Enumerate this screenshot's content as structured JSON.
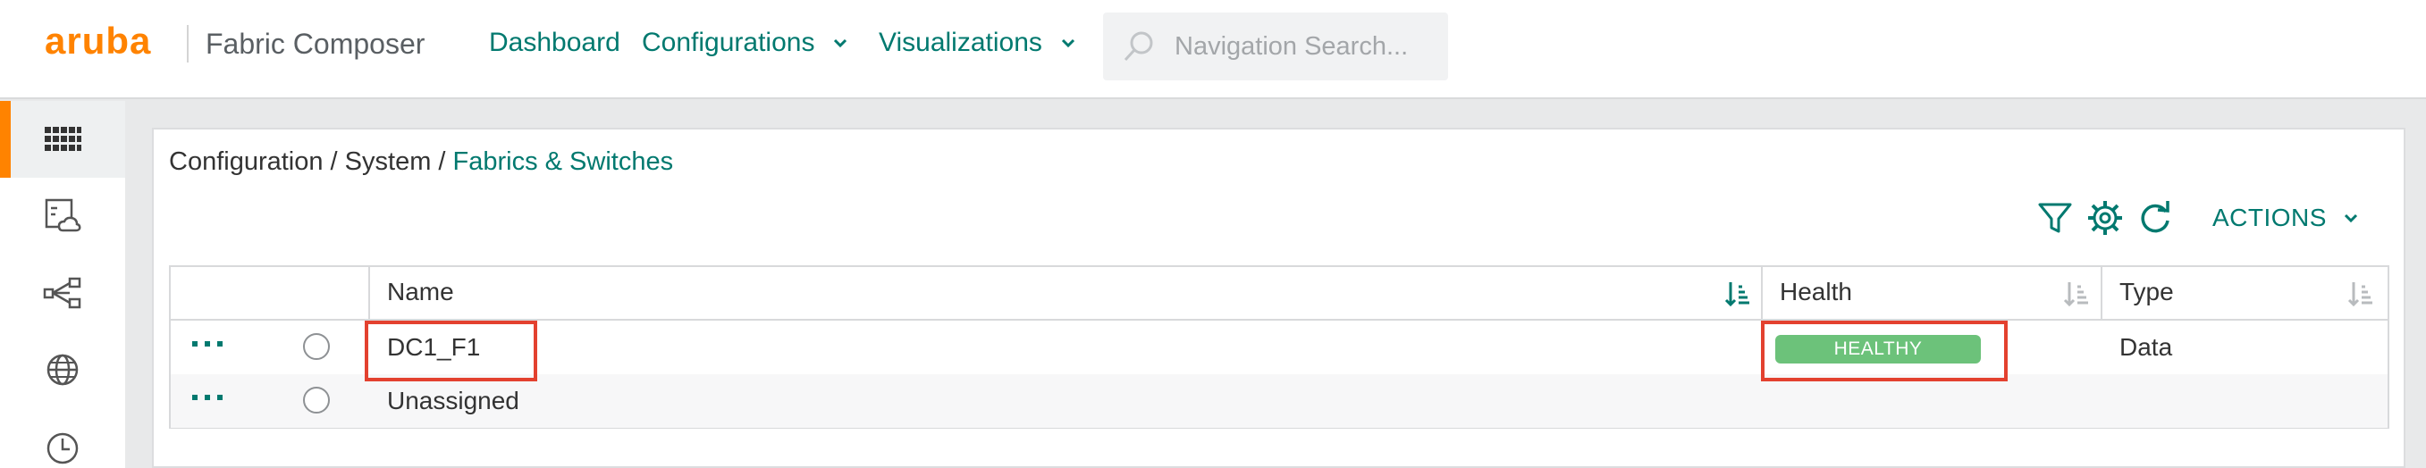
{
  "header": {
    "logo": "aruba",
    "app_name": "Fabric Composer",
    "nav": [
      {
        "label": "Dashboard"
      },
      {
        "label": "Configurations"
      },
      {
        "label": "Visualizations"
      }
    ],
    "search_placeholder": "Navigation Search..."
  },
  "sidebar": {
    "items": [
      {
        "icon": "grid-apps-icon",
        "active": true
      },
      {
        "icon": "image-cloud-icon"
      },
      {
        "icon": "topology-icon"
      },
      {
        "icon": "globe-icon"
      },
      {
        "icon": "clock-icon"
      }
    ]
  },
  "breadcrumb": {
    "part1": "Configuration / System / ",
    "current": "Fabrics & Switches"
  },
  "toolbar": {
    "actions_label": "ACTIONS"
  },
  "table": {
    "columns": {
      "name": "Name",
      "health": "Health",
      "type": "Type"
    },
    "rows": [
      {
        "name": "DC1_F1",
        "health": "HEALTHY",
        "type": "Data"
      },
      {
        "name": "Unassigned",
        "health": "",
        "type": ""
      }
    ]
  },
  "colors": {
    "accent": "#01796f",
    "brand": "#ff8300",
    "healthy": "#6cc27a",
    "highlight": "#e3412f"
  }
}
